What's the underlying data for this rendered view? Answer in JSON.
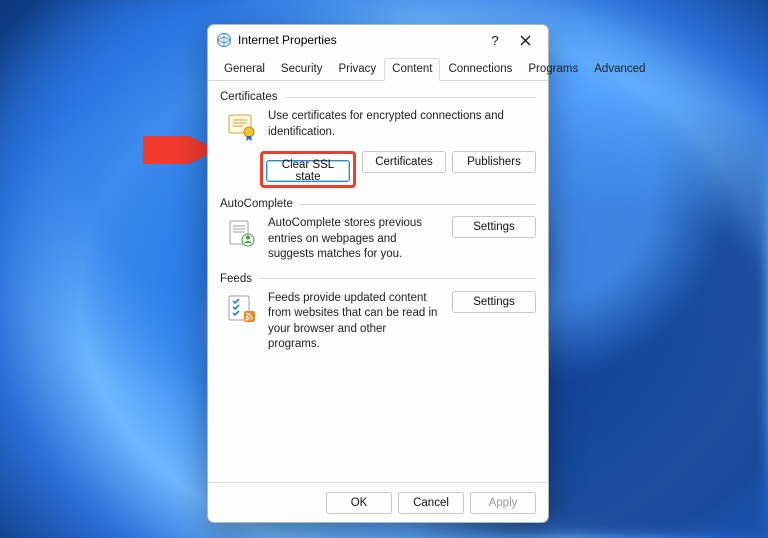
{
  "window": {
    "title": "Internet Properties"
  },
  "tabs": {
    "general": "General",
    "security": "Security",
    "privacy": "Privacy",
    "content": "Content",
    "connections": "Connections",
    "programs": "Programs",
    "advanced": "Advanced"
  },
  "certificates": {
    "group_label": "Certificates",
    "desc": "Use certificates for encrypted connections and identification.",
    "clear_ssl": "Clear SSL state",
    "certificates_btn": "Certificates",
    "publishers_btn": "Publishers"
  },
  "autocomplete": {
    "group_label": "AutoComplete",
    "desc": "AutoComplete stores previous entries on webpages and suggests matches for you.",
    "settings_btn": "Settings"
  },
  "feeds": {
    "group_label": "Feeds",
    "desc": "Feeds provide updated content from websites that can be read in your browser and other programs.",
    "settings_btn": "Settings"
  },
  "footer": {
    "ok": "OK",
    "cancel": "Cancel",
    "apply": "Apply"
  }
}
